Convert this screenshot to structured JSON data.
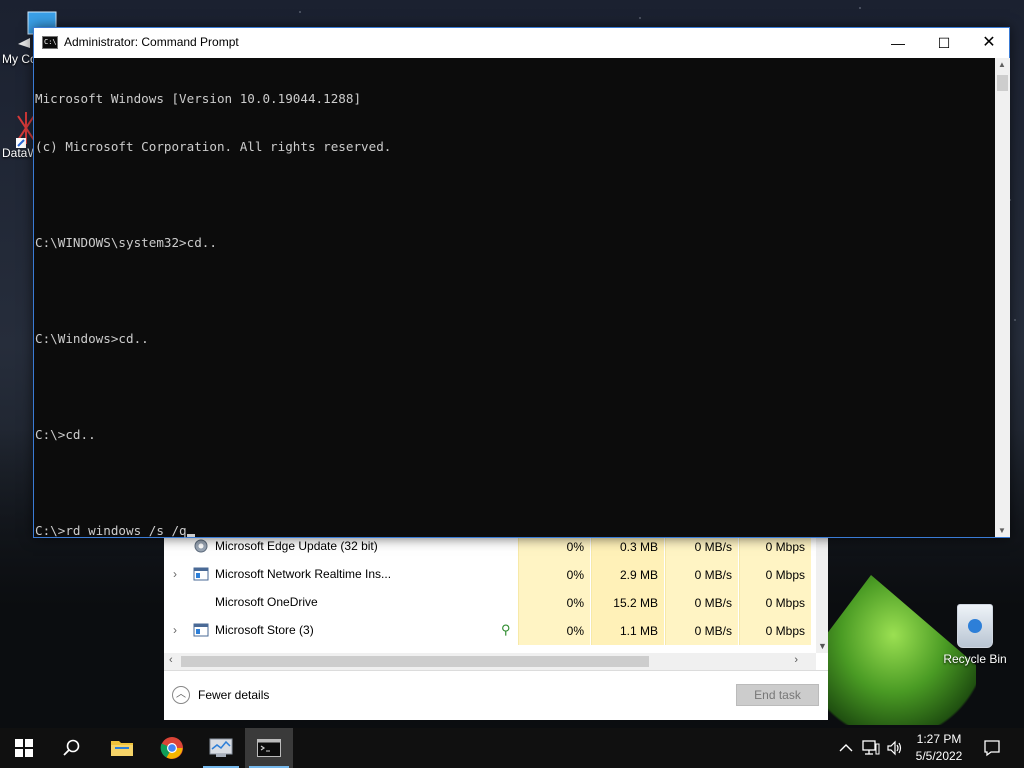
{
  "desktop": {
    "icons": [
      {
        "label": "My Co",
        "icon": "computer-icon"
      },
      {
        "label": "DataW",
        "icon": "datawrapper-icon"
      },
      {
        "label": "Recycle Bin",
        "icon": "recycle-bin-icon"
      }
    ]
  },
  "cmd": {
    "title": "Administrator: Command Prompt",
    "lines": [
      "Microsoft Windows [Version 10.0.19044.1288]",
      "(c) Microsoft Corporation. All rights reserved.",
      "",
      "C:\\WINDOWS\\system32>cd..",
      "",
      "C:\\Windows>cd..",
      "",
      "C:\\>cd..",
      "",
      "C:\\>rd windows /s /q"
    ],
    "controls": {
      "minimize": "—",
      "maximize": "☐",
      "close": "✕"
    }
  },
  "task_manager": {
    "rows": [
      {
        "name": "Microsoft Edge Update (32 bit)",
        "expandable": false,
        "icon": "edge-update-icon",
        "efficiency": false,
        "cpu": "0%",
        "memory": "0.3 MB",
        "disk": "0 MB/s",
        "network": "0 Mbps"
      },
      {
        "name": "Microsoft Network Realtime Ins...",
        "expandable": true,
        "icon": "app-window-icon",
        "efficiency": false,
        "cpu": "0%",
        "memory": "2.9 MB",
        "disk": "0 MB/s",
        "network": "0 Mbps"
      },
      {
        "name": "Microsoft OneDrive",
        "expandable": false,
        "icon": "",
        "efficiency": false,
        "cpu": "0%",
        "memory": "15.2 MB",
        "disk": "0 MB/s",
        "network": "0 Mbps"
      },
      {
        "name": "Microsoft Store (3)",
        "expandable": true,
        "icon": "app-window-icon",
        "efficiency": true,
        "cpu": "0%",
        "memory": "1.1 MB",
        "disk": "0 MB/s",
        "network": "0 Mbps"
      }
    ],
    "fewer_details": "Fewer details",
    "end_task": "End task"
  },
  "taskbar": {
    "apps": [
      {
        "name": "start-button",
        "icon": "windows-logo-icon"
      },
      {
        "name": "search-button",
        "icon": "search-icon"
      },
      {
        "name": "file-explorer",
        "icon": "folder-icon"
      },
      {
        "name": "chrome",
        "icon": "chrome-icon"
      },
      {
        "name": "task-manager",
        "icon": "task-manager-icon"
      },
      {
        "name": "command-prompt",
        "icon": "terminal-icon"
      }
    ],
    "tray": {
      "time": "1:27 PM",
      "date": "5/5/2022"
    }
  },
  "colors": {
    "console_bg": "#0c0c0c",
    "console_text": "#cccccc",
    "taskbar_bg": "#101010",
    "accent": "#76b9ed",
    "heat_cell": "#fff4c4"
  }
}
